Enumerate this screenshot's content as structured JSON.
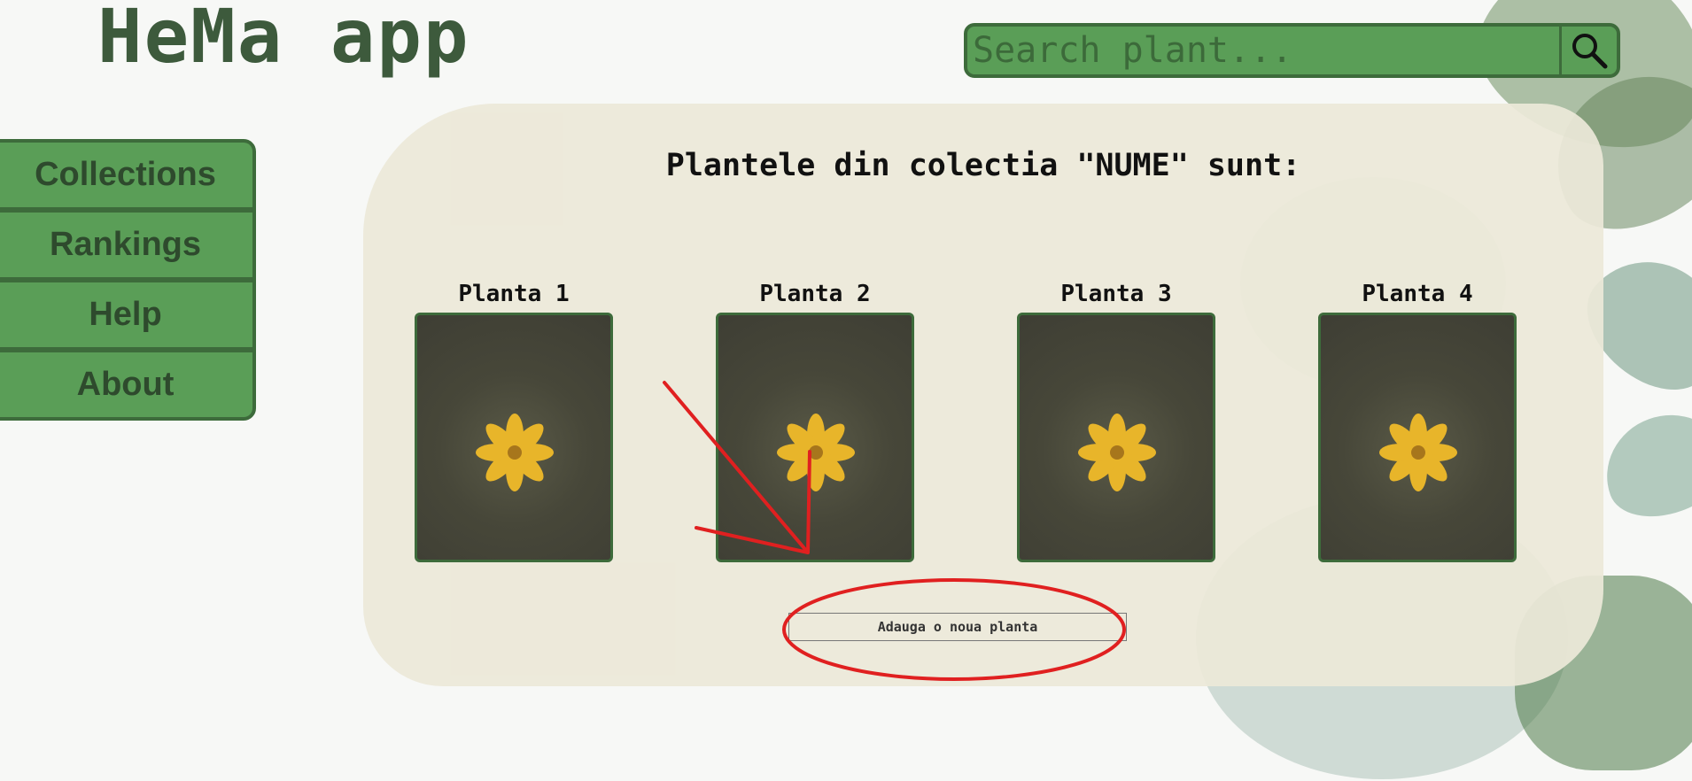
{
  "app": {
    "title": "HeMa app"
  },
  "search": {
    "placeholder": "Search plant...",
    "icon": "search-icon"
  },
  "sidebar": {
    "items": [
      {
        "label": "Collections"
      },
      {
        "label": "Rankings"
      },
      {
        "label": "Help"
      },
      {
        "label": "About"
      }
    ]
  },
  "collection": {
    "heading": "Plantele din colectia \"NUME\" sunt:",
    "plants": [
      {
        "name": "Planta 1"
      },
      {
        "name": "Planta 2"
      },
      {
        "name": "Planta 3"
      },
      {
        "name": "Planta 4"
      }
    ],
    "add_button": "Adauga o noua planta"
  },
  "colors": {
    "brand_green": "#5a9e57",
    "brand_dark_green": "#3d6b3b",
    "title_green": "#3d5a3c",
    "panel_beige": "#ece8d8",
    "annotation_red": "#e02020"
  }
}
